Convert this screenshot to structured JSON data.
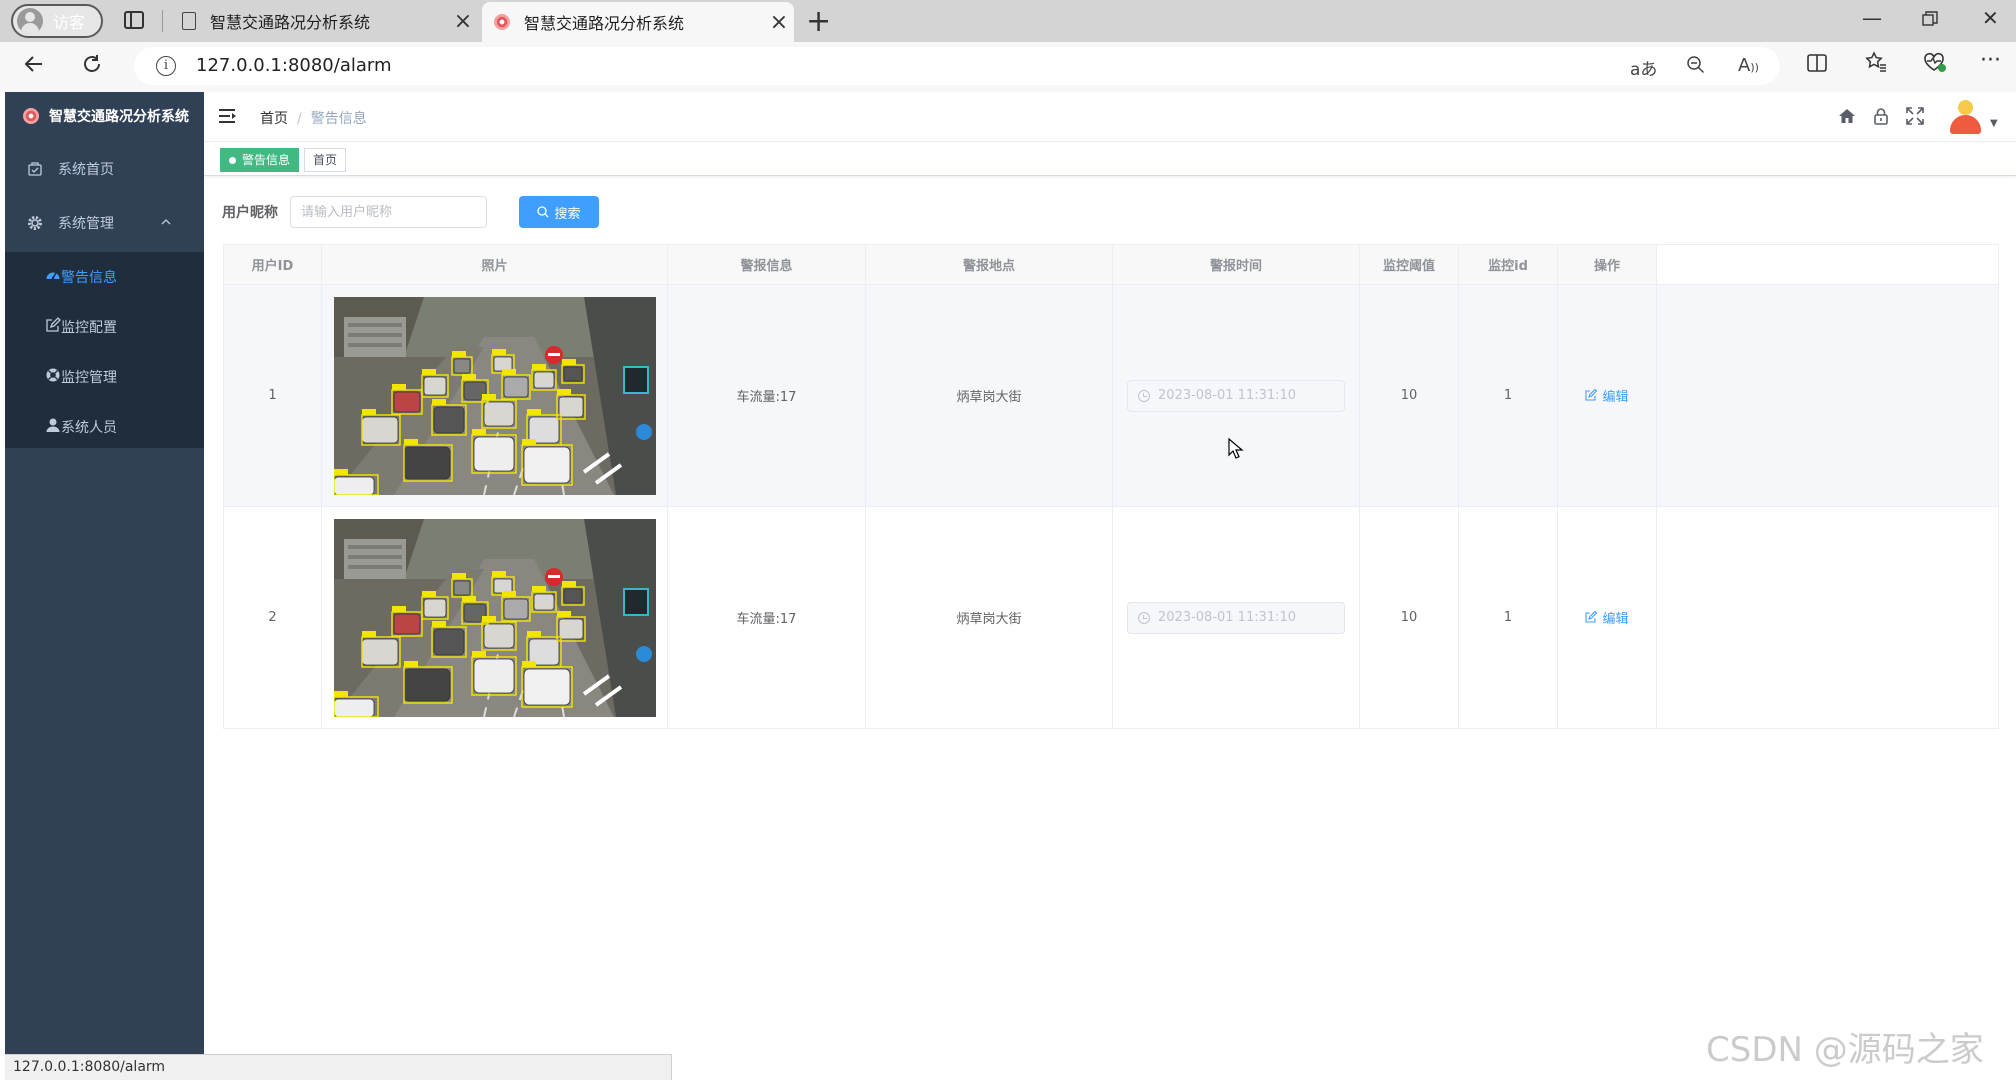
{
  "browser": {
    "profile_label": "访客",
    "tabs": [
      {
        "title": "智慧交通路况分析系统"
      },
      {
        "title": "智慧交通路况分析系统"
      }
    ],
    "url": "127.0.0.1:8080/alarm",
    "status_url": "127.0.0.1:8080/alarm"
  },
  "sidebar": {
    "title": "智慧交通路况分析系统",
    "items": [
      {
        "label": "系统首页"
      },
      {
        "label": "系统管理"
      }
    ],
    "sub_items": [
      {
        "label": "警告信息"
      },
      {
        "label": "监控配置"
      },
      {
        "label": "监控管理"
      },
      {
        "label": "系统人员"
      }
    ]
  },
  "breadcrumb": {
    "home": "首页",
    "separator": "/",
    "current": "警告信息"
  },
  "tags": [
    {
      "label": "警告信息"
    },
    {
      "label": "首页"
    }
  ],
  "search": {
    "label": "用户昵称",
    "placeholder": "请输入用户昵称",
    "button": "搜索"
  },
  "table": {
    "headers": [
      "用户ID",
      "照片",
      "警报信息",
      "警报地点",
      "警报时间",
      "监控阈值",
      "监控id",
      "操作"
    ],
    "rows": [
      {
        "id": "1",
        "info": "车流量:17",
        "location": "炳草岗大街",
        "time": "2023-08-01 11:31:10",
        "threshold": "10",
        "monitor_id": "1",
        "action": "编辑"
      },
      {
        "id": "2",
        "info": "车流量:17",
        "location": "炳草岗大街",
        "time": "2023-08-01 11:31:10",
        "threshold": "10",
        "monitor_id": "1",
        "action": "编辑"
      }
    ]
  },
  "watermark": "CSDN @源码之家",
  "colors": {
    "sidebar_bg": "#304156",
    "submenu_bg": "#1f2d3d",
    "primary": "#409eff",
    "tag_active": "#42b983"
  }
}
